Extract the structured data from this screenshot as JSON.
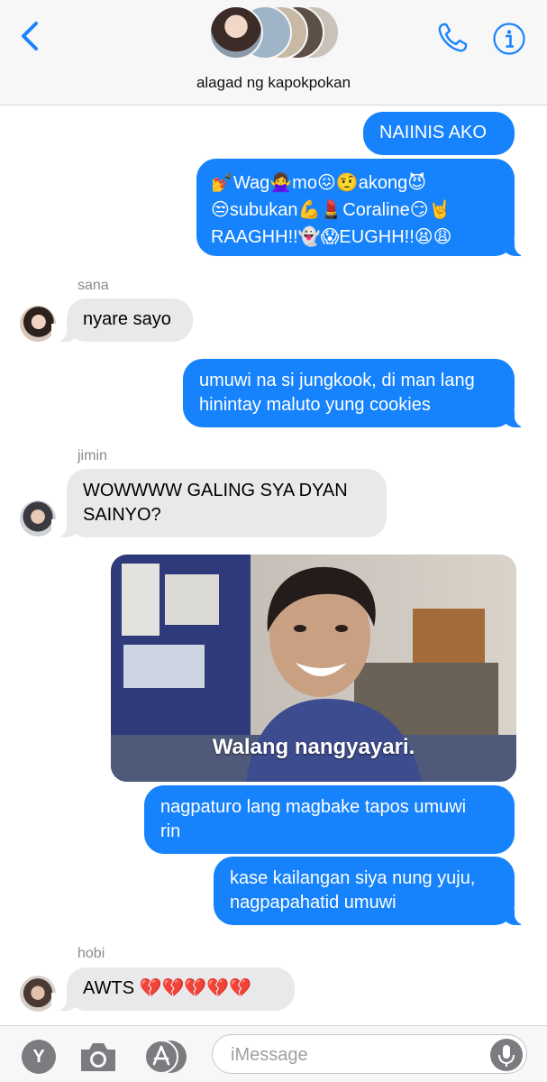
{
  "header": {
    "group_name": "alagad ng kapokpokan"
  },
  "messages": {
    "m1": "NAIINIS AKO",
    "m2_line1": "💅Wag🙅‍♀️mo😖🤨akong😈",
    "m2_line2": "😒subukan💪💄Coraline😏🤘",
    "m2_line3": "RAAGHH!!👻😱EUGHH!!😫😩",
    "sana_name": "sana",
    "m3": "nyare sayo",
    "m4_line1": "umuwi na si jungkook, di man lang",
    "m4_line2": "hinintay maluto yung cookies",
    "jimin_name": "jimin",
    "m5_line1": "WOWWWW GALING SYA DYAN",
    "m5_line2": "SAINYO?",
    "image_caption": "Walang nangyayari.",
    "m6_line1": "nagpaturo lang magbake tapos umuwi",
    "m6_line2": "rin",
    "m7_line1": "kase kailangan siya nung yuju,",
    "m7_line2": "nagpapahatid umuwi",
    "hobi_name": "hobi",
    "m8": "AWTS 💔💔💔💔💔"
  },
  "composer": {
    "y_label": "Y",
    "placeholder": "iMessage"
  },
  "colors": {
    "accent": "#1682fb",
    "incoming": "#e9e9eb",
    "ios_blue": "#1a84ff"
  },
  "icons": [
    "chevron-left-icon",
    "phone-icon",
    "info-icon",
    "camera-icon",
    "app-store-icon",
    "microphone-icon"
  ]
}
